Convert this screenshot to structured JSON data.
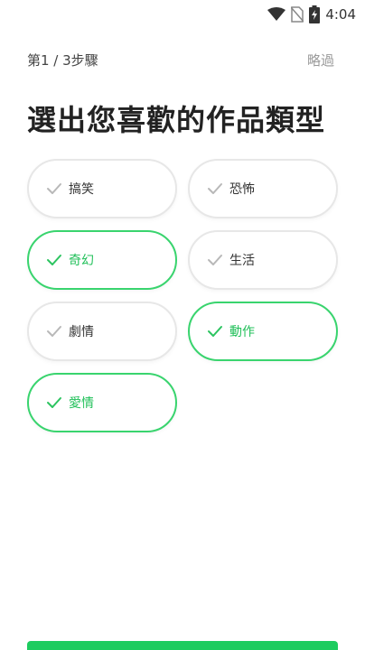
{
  "status_bar": {
    "time": "4:04"
  },
  "header": {
    "step": "第1 / 3步驟",
    "skip": "略過",
    "title": "選出您喜歡的作品類型"
  },
  "genres": [
    {
      "label": "搞笑",
      "selected": false
    },
    {
      "label": "恐怖",
      "selected": false
    },
    {
      "label": "奇幻",
      "selected": true
    },
    {
      "label": "生活",
      "selected": false
    },
    {
      "label": "劇情",
      "selected": false
    },
    {
      "label": "動作",
      "selected": true
    },
    {
      "label": "愛情",
      "selected": true
    }
  ],
  "colors": {
    "accent": "#22c05a",
    "selected_border": "#39d46e",
    "unselected_border": "#e7e7e7",
    "check_inactive": "#b8b8b8"
  }
}
